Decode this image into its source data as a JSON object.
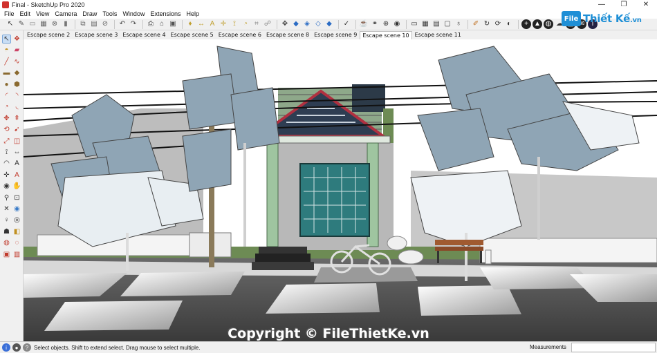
{
  "window": {
    "title": "Final - SketchUp Pro 2020",
    "minimize": "—",
    "restore": "❐",
    "close": "✕"
  },
  "menu": [
    "File",
    "Edit",
    "View",
    "Camera",
    "Draw",
    "Tools",
    "Window",
    "Extensions",
    "Help"
  ],
  "toolbar_icons": [
    {
      "name": "arrow-select-icon",
      "glyph": "↖",
      "color": "#333333"
    },
    {
      "name": "pencil-icon",
      "glyph": "✎",
      "color": "#555555"
    },
    {
      "name": "eraser-icon",
      "glyph": "▭",
      "color": "#888888"
    },
    {
      "name": "bucket-icon",
      "glyph": "▦",
      "color": "#666666"
    },
    {
      "name": "stop-icon",
      "glyph": "⊗",
      "color": "#666666"
    },
    {
      "name": "bookmark-icon",
      "glyph": "▮",
      "color": "#777777"
    },
    {
      "name": "copy-icon",
      "glyph": "⧉",
      "color": "#666666"
    },
    {
      "name": "paste-icon",
      "glyph": "▤",
      "color": "#666666"
    },
    {
      "name": "delete-icon",
      "glyph": "⊘",
      "color": "#666666"
    },
    {
      "name": "undo-icon",
      "glyph": "↶",
      "color": "#444444"
    },
    {
      "name": "redo-icon",
      "glyph": "↷",
      "color": "#444444"
    },
    {
      "name": "print-icon",
      "glyph": "⎙",
      "color": "#444444"
    },
    {
      "name": "house-icon",
      "glyph": "⌂",
      "color": "#444444"
    },
    {
      "name": "model-info-icon",
      "glyph": "▣",
      "color": "#555555"
    },
    {
      "name": "paint-icon",
      "glyph": "♦",
      "color": "#c0a030"
    },
    {
      "name": "dimension-icon",
      "glyph": "↔",
      "color": "#c0a030"
    },
    {
      "name": "text-icon",
      "glyph": "A",
      "color": "#c0a030"
    },
    {
      "name": "axes-icon",
      "glyph": "✛",
      "color": "#c0a030"
    },
    {
      "name": "tape-icon",
      "glyph": "⟟",
      "color": "#c0a030"
    },
    {
      "name": "protractor-icon",
      "glyph": "◔",
      "color": "#c0a030"
    },
    {
      "name": "section-icon",
      "glyph": "⌗",
      "color": "#888888"
    },
    {
      "name": "walk-icon",
      "glyph": "☍",
      "color": "#888888"
    },
    {
      "name": "orbit-icon",
      "glyph": "✥",
      "color": "#444444"
    },
    {
      "name": "iso-view-icon",
      "glyph": "◆",
      "color": "#2b6cc4"
    },
    {
      "name": "top-view-icon",
      "glyph": "◈",
      "color": "#2b6cc4"
    },
    {
      "name": "front-view-icon",
      "glyph": "◇",
      "color": "#2b6cc4"
    },
    {
      "name": "right-view-icon",
      "glyph": "◆",
      "color": "#2b6cc4"
    },
    {
      "name": "check-icon",
      "glyph": "✓",
      "color": "#333333"
    },
    {
      "name": "teapot-icon",
      "glyph": "☕",
      "color": "#333333"
    },
    {
      "name": "link-icon",
      "glyph": "⚭",
      "color": "#333333"
    },
    {
      "name": "pin-icon",
      "glyph": "⊕",
      "color": "#333333"
    },
    {
      "name": "camera-icon",
      "glyph": "◉",
      "color": "#333333"
    },
    {
      "name": "display-icon",
      "glyph": "▭",
      "color": "#333333"
    },
    {
      "name": "grid-icon",
      "glyph": "▦",
      "color": "#333333"
    },
    {
      "name": "layers-icon",
      "glyph": "▤",
      "color": "#333333"
    },
    {
      "name": "frame-icon",
      "glyph": "▢",
      "color": "#333333"
    },
    {
      "name": "bulb-icon",
      "glyph": "♁",
      "color": "#333333"
    },
    {
      "name": "brush-icon",
      "glyph": "✐",
      "color": "#c07020"
    },
    {
      "name": "refresh-icon",
      "glyph": "↻",
      "color": "#333333"
    },
    {
      "name": "sync-icon",
      "glyph": "⟳",
      "color": "#333333"
    },
    {
      "name": "render-icon",
      "glyph": "◐",
      "color": "#333333"
    },
    {
      "name": "plus-icon",
      "glyph": "+",
      "color": "#ffffff",
      "bg": "#222222"
    },
    {
      "name": "leaf-icon",
      "glyph": "▲",
      "color": "#ffffff",
      "bg": "#222222"
    },
    {
      "name": "globe-icon",
      "glyph": "◍",
      "color": "#ffffff",
      "bg": "#222222"
    },
    {
      "name": "cloud-icon",
      "glyph": "☁",
      "color": "#333333"
    },
    {
      "name": "extension-icon",
      "glyph": "◭",
      "color": "#ffffff",
      "bg": "#222222"
    },
    {
      "name": "mail-icon",
      "glyph": "✉",
      "color": "#ffffff",
      "bg": "#222222"
    },
    {
      "name": "info-icon",
      "glyph": "i",
      "color": "#ffffff",
      "bg": "#222244"
    }
  ],
  "logo": {
    "mark": "File",
    "name": "Thiết Kế",
    "tld": ".vn"
  },
  "left_tools": [
    {
      "name": "select-tool-icon",
      "glyph": "↖",
      "color": "#333333"
    },
    {
      "name": "make-component-icon",
      "glyph": "❖",
      "color": "#c0392b"
    },
    {
      "name": "paint-bucket-icon",
      "glyph": "◓",
      "color": "#c09020"
    },
    {
      "name": "eraser-tool-icon",
      "glyph": "▰",
      "color": "#cc4466"
    },
    {
      "name": "line-tool-icon",
      "glyph": "╱",
      "color": "#c0392b"
    },
    {
      "name": "freehand-tool-icon",
      "glyph": "∿",
      "color": "#c0392b"
    },
    {
      "name": "rectangle-tool-icon",
      "glyph": "▬",
      "color": "#8a6a30"
    },
    {
      "name": "rotated-rect-icon",
      "glyph": "◆",
      "color": "#8a6a30"
    },
    {
      "name": "circle-tool-icon",
      "glyph": "●",
      "color": "#8a6a30"
    },
    {
      "name": "polygon-tool-icon",
      "glyph": "⬢",
      "color": "#8a6a30"
    },
    {
      "name": "arc-tool-icon",
      "glyph": "◜",
      "color": "#c0392b"
    },
    {
      "name": "arc2-tool-icon",
      "glyph": "◝",
      "color": "#c0392b"
    },
    {
      "name": "pie-tool-icon",
      "glyph": "◔",
      "color": "#c0392b"
    },
    {
      "name": "arc3-tool-icon",
      "glyph": "◟",
      "color": "#c0392b"
    },
    {
      "name": "move-tool-icon",
      "glyph": "✥",
      "color": "#c0392b"
    },
    {
      "name": "push-pull-icon",
      "glyph": "⇞",
      "color": "#c0392b"
    },
    {
      "name": "rotate-tool-icon",
      "glyph": "⟲",
      "color": "#c0392b"
    },
    {
      "name": "follow-me-icon",
      "glyph": "➹",
      "color": "#c0392b"
    },
    {
      "name": "scale-tool-icon",
      "glyph": "⤢",
      "color": "#c0392b"
    },
    {
      "name": "offset-tool-icon",
      "glyph": "◫",
      "color": "#c0392b"
    },
    {
      "name": "tape-measure-icon",
      "glyph": "⟟",
      "color": "#333333"
    },
    {
      "name": "dimension-tool-icon",
      "glyph": "⇔",
      "color": "#333333"
    },
    {
      "name": "protractor-tool-icon",
      "glyph": "◠",
      "color": "#333333"
    },
    {
      "name": "text-tool-icon",
      "glyph": "A",
      "color": "#333333"
    },
    {
      "name": "axes-tool-icon",
      "glyph": "✛",
      "color": "#333333"
    },
    {
      "name": "3d-text-icon",
      "glyph": "A",
      "color": "#c0392b"
    },
    {
      "name": "orbit-tool-icon",
      "glyph": "◉",
      "color": "#333333"
    },
    {
      "name": "pan-tool-icon",
      "glyph": "✋",
      "color": "#333333"
    },
    {
      "name": "zoom-tool-icon",
      "glyph": "⚲",
      "color": "#333333"
    },
    {
      "name": "zoom-window-icon",
      "glyph": "⊡",
      "color": "#333333"
    },
    {
      "name": "zoom-extents-icon",
      "glyph": "✕",
      "color": "#333333"
    },
    {
      "name": "previous-view-icon",
      "glyph": "◉",
      "color": "#3a7cc8"
    },
    {
      "name": "position-camera-icon",
      "glyph": "♀",
      "color": "#333333"
    },
    {
      "name": "look-around-icon",
      "glyph": "◎",
      "color": "#333333"
    },
    {
      "name": "walk-tool-icon",
      "glyph": "☗",
      "color": "#333333"
    },
    {
      "name": "section-plane-icon",
      "glyph": "◧",
      "color": "#c09020"
    },
    {
      "name": "sandbox-icon",
      "glyph": "◍",
      "color": "#c0392b"
    },
    {
      "name": "sandbox2-icon",
      "glyph": "◌",
      "color": "#c0392b"
    },
    {
      "name": "warehouse-icon",
      "glyph": "▣",
      "color": "#c0392b"
    },
    {
      "name": "extension-wh-icon",
      "glyph": "▥",
      "color": "#c0392b"
    }
  ],
  "scenes": [
    {
      "label": "Escape scene 2",
      "active": false
    },
    {
      "label": "Escape scene 3",
      "active": false
    },
    {
      "label": "Escape scene 4",
      "active": false
    },
    {
      "label": "Escape scene 5",
      "active": false
    },
    {
      "label": "Escape scene 6",
      "active": false
    },
    {
      "label": "Escape scene 8",
      "active": false
    },
    {
      "label": "Escape scene 9",
      "active": false
    },
    {
      "label": "Escape scene 10",
      "active": true
    },
    {
      "label": "Escape scene 11",
      "active": false
    }
  ],
  "watermark": "Copyright © FileThietKe.vn",
  "status": {
    "icons": [
      {
        "name": "status-info-icon",
        "glyph": "i",
        "color": "#ffffff",
        "bg": "#3a6fd8"
      },
      {
        "name": "status-user-icon",
        "glyph": "●",
        "color": "#ffffff",
        "bg": "#555555"
      },
      {
        "name": "status-help-icon",
        "glyph": "?",
        "color": "#ffffff",
        "bg": "#888888"
      }
    ],
    "message": "Select objects. Shift to extend select. Drag mouse to select multiple.",
    "measurements_label": "Measurements",
    "measurements_value": ""
  }
}
